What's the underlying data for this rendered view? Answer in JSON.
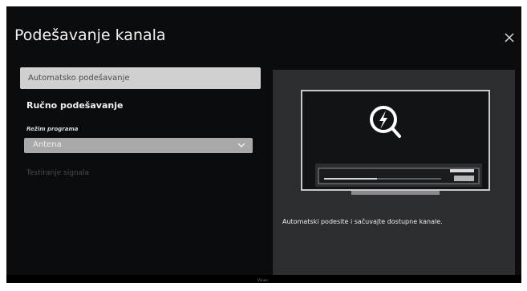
{
  "header": {
    "title": "Podešavanje kanala"
  },
  "menu": {
    "auto_label": "Automatsko podešavanje",
    "manual_label": "Ručno podešavanje",
    "mode_label": "Režim programa",
    "mode_value": "Antena",
    "test_label": "Testiranje signala"
  },
  "preview": {
    "description": "Automatski podesite i sačuvajte dostupne kanale."
  },
  "footer": {
    "brand": "Vision"
  },
  "colors": {
    "background": "#0b0c0e",
    "panel": "#2b2d31",
    "selected_item": "#d0d0d0",
    "dropdown": "#a9a9a9"
  },
  "icons": {
    "close": "close-icon",
    "dropdown": "chevron-down-icon",
    "search": "search-icon",
    "signal": "lightning-icon"
  }
}
